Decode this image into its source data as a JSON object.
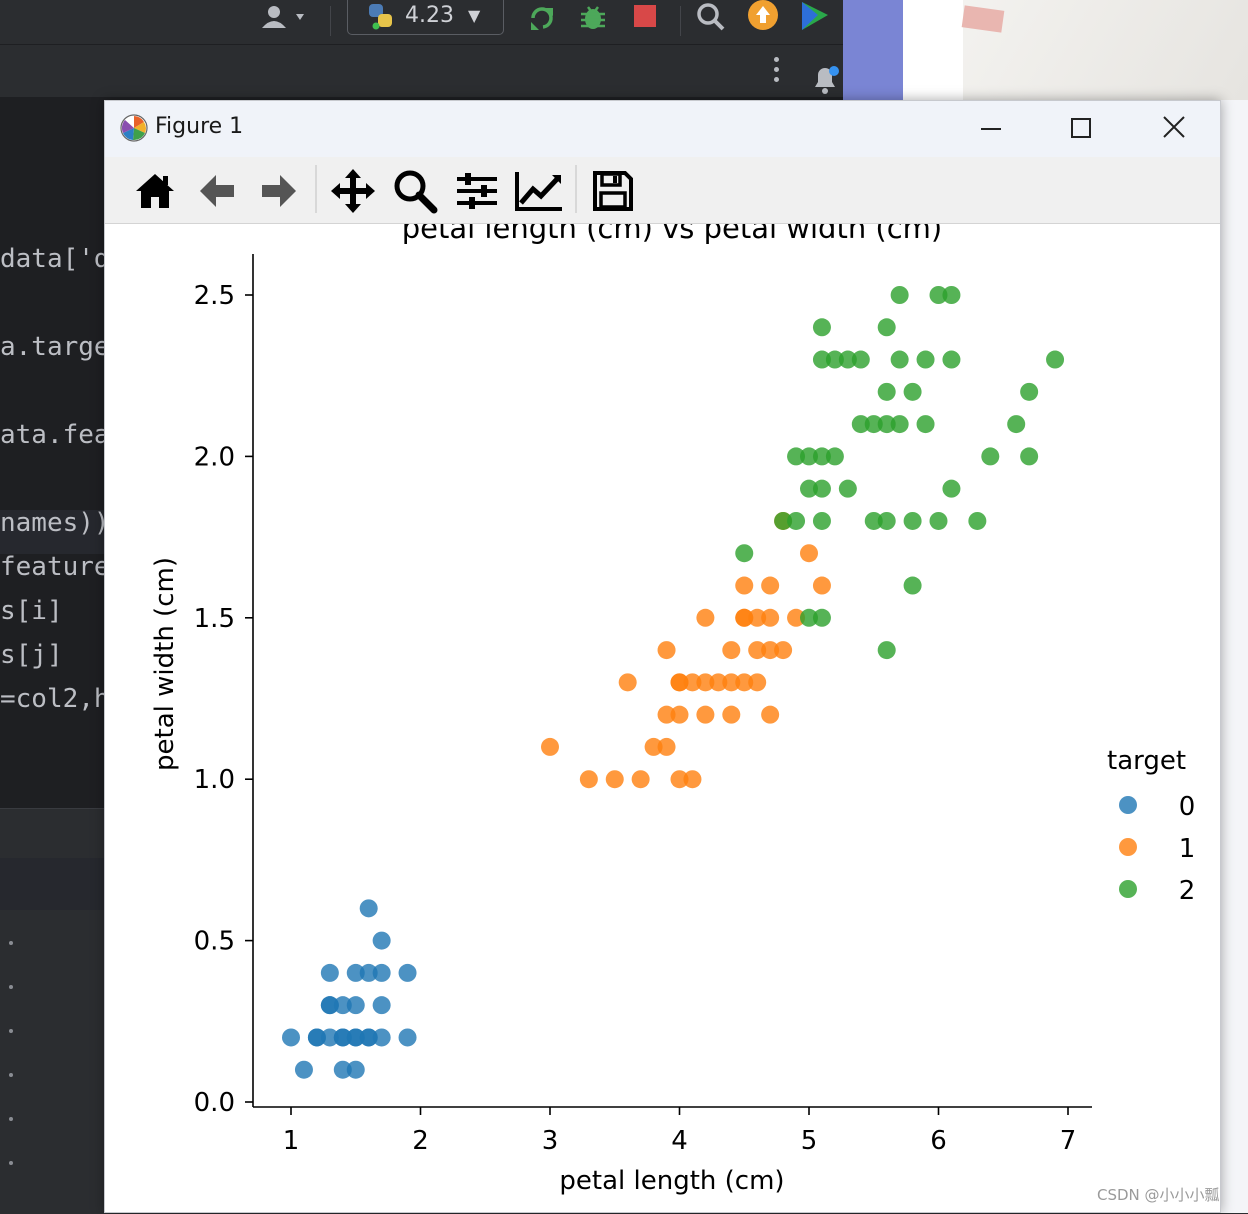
{
  "ide": {
    "python_version": "4.23",
    "code_lines": [
      "data['d",
      "a.targe",
      "ata.fea",
      "names))",
      "feature",
      "s[i]",
      "s[j]",
      "=col2,h"
    ]
  },
  "window": {
    "title": "Figure 1"
  },
  "toolbar": {
    "buttons": [
      "home-icon",
      "back-icon",
      "forward-icon",
      "pan-icon",
      "zoom-icon",
      "configure-subplots-icon",
      "edit-axes-icon",
      "save-icon"
    ]
  },
  "watermark": "CSDN @小小小瓢",
  "chart_data": {
    "type": "scatter",
    "title": "petal length (cm) vs petal width (cm)",
    "xlabel": "petal length (cm)",
    "ylabel": "petal width (cm)",
    "xlim": [
      0.7,
      7.2
    ],
    "ylim": [
      -0.02,
      2.62
    ],
    "xticks": [
      "1",
      "2",
      "3",
      "4",
      "5",
      "6",
      "7"
    ],
    "yticks": [
      "0.0",
      "0.5",
      "1.0",
      "1.5",
      "2.0",
      "2.5"
    ],
    "legend_title": "target",
    "legend_position": "right",
    "series": [
      {
        "name": "0",
        "color": "#1f77b4",
        "points": [
          [
            1.0,
            0.2
          ],
          [
            1.1,
            0.1
          ],
          [
            1.2,
            0.2
          ],
          [
            1.3,
            0.2
          ],
          [
            1.3,
            0.3
          ],
          [
            1.3,
            0.4
          ],
          [
            1.4,
            0.1
          ],
          [
            1.4,
            0.2
          ],
          [
            1.4,
            0.3
          ],
          [
            1.5,
            0.1
          ],
          [
            1.5,
            0.2
          ],
          [
            1.5,
            0.3
          ],
          [
            1.5,
            0.4
          ],
          [
            1.6,
            0.2
          ],
          [
            1.6,
            0.4
          ],
          [
            1.6,
            0.6
          ],
          [
            1.7,
            0.2
          ],
          [
            1.7,
            0.3
          ],
          [
            1.7,
            0.4
          ],
          [
            1.7,
            0.5
          ],
          [
            1.9,
            0.2
          ],
          [
            1.9,
            0.4
          ],
          [
            1.4,
            0.2
          ],
          [
            1.5,
            0.2
          ],
          [
            1.6,
            0.2
          ],
          [
            1.2,
            0.2
          ],
          [
            1.3,
            0.3
          ]
        ]
      },
      {
        "name": "1",
        "color": "#ff7f0e",
        "points": [
          [
            3.0,
            1.1
          ],
          [
            3.3,
            1.0
          ],
          [
            3.5,
            1.0
          ],
          [
            3.7,
            1.0
          ],
          [
            3.6,
            1.3
          ],
          [
            3.8,
            1.1
          ],
          [
            3.9,
            1.1
          ],
          [
            3.9,
            1.2
          ],
          [
            3.9,
            1.4
          ],
          [
            4.0,
            1.0
          ],
          [
            4.0,
            1.2
          ],
          [
            4.0,
            1.3
          ],
          [
            4.1,
            1.0
          ],
          [
            4.1,
            1.3
          ],
          [
            4.2,
            1.2
          ],
          [
            4.2,
            1.3
          ],
          [
            4.2,
            1.5
          ],
          [
            4.3,
            1.3
          ],
          [
            4.4,
            1.2
          ],
          [
            4.4,
            1.3
          ],
          [
            4.4,
            1.4
          ],
          [
            4.5,
            1.3
          ],
          [
            4.5,
            1.5
          ],
          [
            4.5,
            1.6
          ],
          [
            4.6,
            1.3
          ],
          [
            4.6,
            1.4
          ],
          [
            4.6,
            1.5
          ],
          [
            4.7,
            1.2
          ],
          [
            4.7,
            1.4
          ],
          [
            4.7,
            1.5
          ],
          [
            4.7,
            1.6
          ],
          [
            4.8,
            1.4
          ],
          [
            4.8,
            1.8
          ],
          [
            4.9,
            1.5
          ],
          [
            5.0,
            1.7
          ],
          [
            5.1,
            1.6
          ],
          [
            4.0,
            1.3
          ],
          [
            4.5,
            1.5
          ]
        ]
      },
      {
        "name": "2",
        "color": "#2ca02c",
        "points": [
          [
            4.5,
            1.7
          ],
          [
            4.8,
            1.8
          ],
          [
            4.9,
            1.8
          ],
          [
            4.9,
            2.0
          ],
          [
            5.0,
            1.5
          ],
          [
            5.0,
            1.9
          ],
          [
            5.0,
            2.0
          ],
          [
            5.1,
            1.5
          ],
          [
            5.1,
            1.8
          ],
          [
            5.1,
            1.9
          ],
          [
            5.1,
            2.0
          ],
          [
            5.1,
            2.3
          ],
          [
            5.1,
            2.4
          ],
          [
            5.2,
            2.0
          ],
          [
            5.2,
            2.3
          ],
          [
            5.3,
            1.9
          ],
          [
            5.3,
            2.3
          ],
          [
            5.4,
            2.1
          ],
          [
            5.4,
            2.3
          ],
          [
            5.5,
            1.8
          ],
          [
            5.5,
            2.1
          ],
          [
            5.6,
            1.4
          ],
          [
            5.6,
            1.8
          ],
          [
            5.6,
            2.1
          ],
          [
            5.6,
            2.2
          ],
          [
            5.6,
            2.4
          ],
          [
            5.7,
            2.1
          ],
          [
            5.7,
            2.3
          ],
          [
            5.7,
            2.5
          ],
          [
            5.8,
            1.6
          ],
          [
            5.8,
            1.8
          ],
          [
            5.8,
            2.2
          ],
          [
            5.9,
            2.1
          ],
          [
            5.9,
            2.3
          ],
          [
            6.0,
            1.8
          ],
          [
            6.0,
            2.5
          ],
          [
            6.1,
            1.9
          ],
          [
            6.1,
            2.3
          ],
          [
            6.1,
            2.5
          ],
          [
            6.3,
            1.8
          ],
          [
            6.4,
            2.0
          ],
          [
            6.6,
            2.1
          ],
          [
            6.7,
            2.0
          ],
          [
            6.7,
            2.2
          ],
          [
            6.9,
            2.3
          ]
        ]
      }
    ]
  }
}
